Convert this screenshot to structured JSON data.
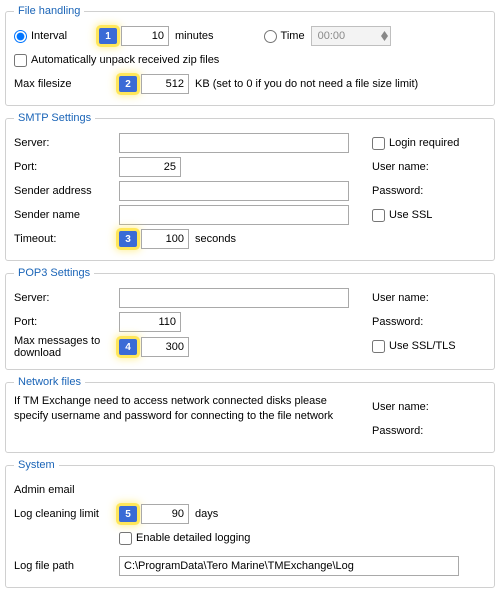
{
  "fileHandling": {
    "legend": "File handling",
    "intervalLabel": "Interval",
    "intervalBadge": "1",
    "intervalValue": "10",
    "intervalUnit": "minutes",
    "timeLabel": "Time",
    "timeValue": "00:00",
    "autoUnpackLabel": "Automatically unpack received zip files",
    "maxFilesizeLabel": "Max filesize",
    "maxFilesizeBadge": "2",
    "maxFilesizeValue": "512",
    "maxFilesizeUnit": "KB (set to 0 if you do not need a file size limit)"
  },
  "smtp": {
    "legend": "SMTP Settings",
    "serverLabel": "Server:",
    "portLabel": "Port:",
    "portValue": "25",
    "senderAddrLabel": "Sender address",
    "senderNameLabel": "Sender name",
    "timeoutLabel": "Timeout:",
    "timeoutBadge": "3",
    "timeoutValue": "100",
    "timeoutUnit": "seconds",
    "loginReqLabel": "Login required",
    "userLabel": "User name:",
    "passLabel": "Password:",
    "sslLabel": "Use SSL"
  },
  "pop3": {
    "legend": "POP3 Settings",
    "serverLabel": "Server:",
    "portLabel": "Port:",
    "portValue": "110",
    "maxMsgLabel": "Max messages to download",
    "maxMsgBadge": "4",
    "maxMsgValue": "300",
    "userLabel": "User name:",
    "passLabel": "Password:",
    "sslLabel": "Use SSL/TLS"
  },
  "network": {
    "legend": "Network files",
    "note": "If TM Exchange need to access network connected disks please specify username and password for connecting to the file network",
    "userLabel": "User name:",
    "passLabel": "Password:"
  },
  "system": {
    "legend": "System",
    "adminEmailLabel": "Admin email",
    "logLimitLabel": "Log cleaning limit",
    "logLimitBadge": "5",
    "logLimitValue": "90",
    "logLimitUnit": "days",
    "detailedLogLabel": "Enable detailed logging",
    "logPathLabel": "Log file path",
    "logPathValue": "C:\\ProgramData\\Tero Marine\\TMExchange\\Log"
  }
}
